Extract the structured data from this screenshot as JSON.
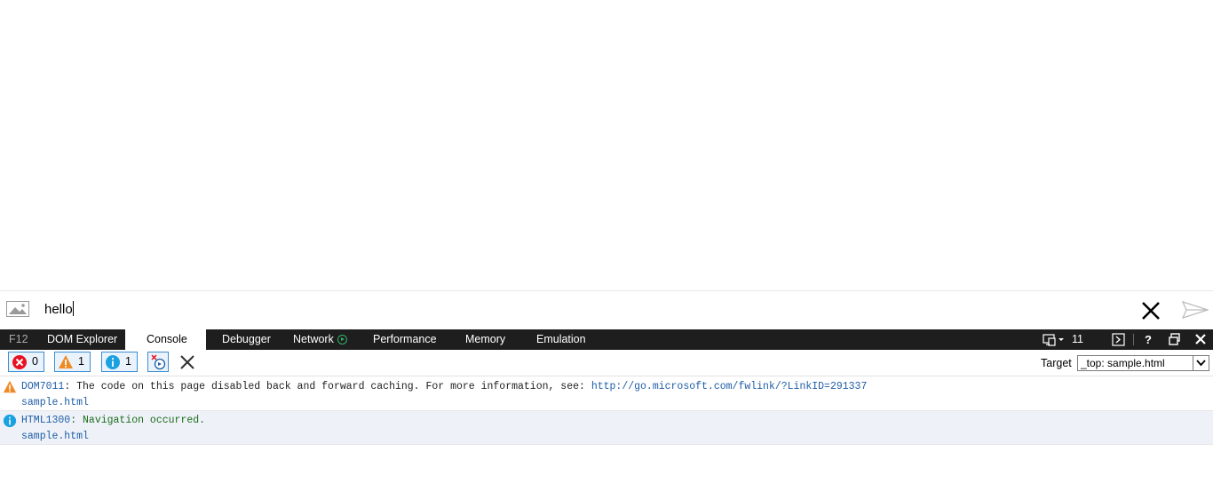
{
  "input_bar": {
    "value": "hello",
    "icons": [
      "image-icon",
      "close-icon",
      "send-icon"
    ]
  },
  "devtools": {
    "tabs": [
      "F12",
      "DOM Explorer",
      "Console",
      "Debugger",
      "Network",
      "Performance",
      "Memory",
      "Emulation"
    ],
    "active_tab": "Console",
    "document_mode": "11"
  },
  "console": {
    "filters": {
      "errors": "0",
      "warnings": "1",
      "messages": "1"
    },
    "target_label": "Target",
    "target_value": "_top: sample.html",
    "messages": [
      {
        "type": "warning",
        "code": "DOM7011",
        "text": ": The code on this page disabled back and forward caching. For more information, see: ",
        "link": "http://go.microsoft.com/fwlink/?LinkID=291337",
        "source": "sample.html"
      },
      {
        "type": "info",
        "code": "HTML1300",
        "text": ": Navigation occurred.",
        "source": "sample.html"
      }
    ]
  },
  "colors": {
    "tabbar_bg": "#1e1e1e",
    "warning": "#f08a24",
    "info": "#1ba1e2",
    "error": "#e81123",
    "link": "#1f5ea8"
  }
}
